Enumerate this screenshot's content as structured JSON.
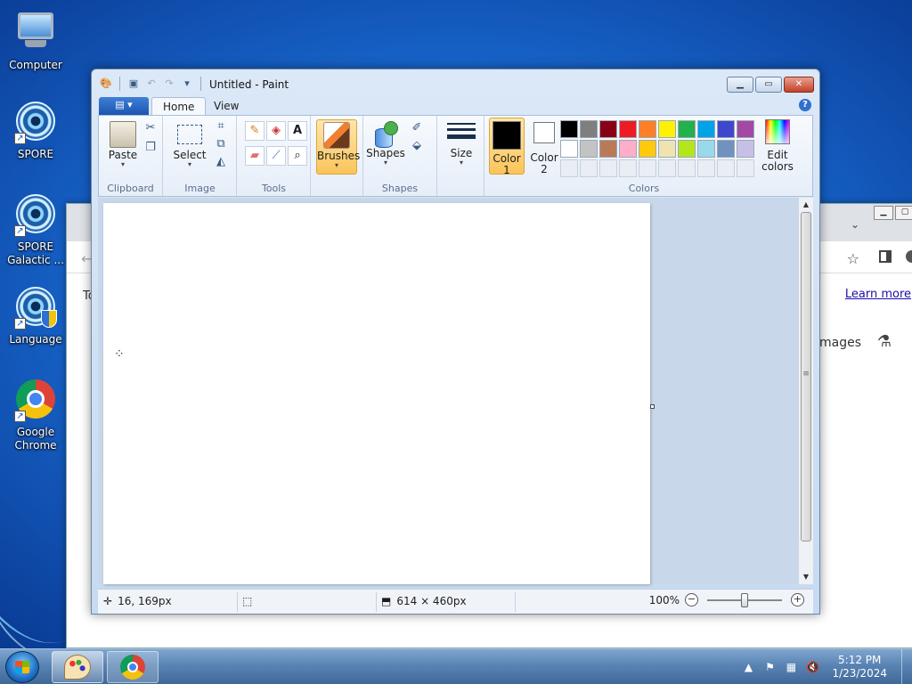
{
  "desktop": {
    "icons": [
      {
        "label": "Computer"
      },
      {
        "label": "SPORE"
      },
      {
        "label": "SPORE Galactic ..."
      },
      {
        "label": "Language"
      },
      {
        "label": "Google Chrome"
      }
    ]
  },
  "chrome_window": {
    "learn_more": "Learn more",
    "images": "Images",
    "partial_text": "To"
  },
  "paint": {
    "title": "Untitled - Paint",
    "tabs": [
      {
        "label": "Home"
      },
      {
        "label": "View"
      }
    ],
    "groups": {
      "clipboard": "Clipboard",
      "image": "Image",
      "tools": "Tools",
      "shapes": "Shapes",
      "colors": "Colors"
    },
    "buttons": {
      "paste": "Paste",
      "select": "Select",
      "brushes": "Brushes",
      "shapes": "Shapes",
      "size": "Size",
      "color1": "Color 1",
      "color2": "Color 2",
      "edit_colors": "Edit colors"
    },
    "color1": "#000000",
    "color2": "#ffffff",
    "palette_row1": [
      "#000000",
      "#7f7f7f",
      "#880015",
      "#ed1c24",
      "#ff7f27",
      "#fff200",
      "#22b14c",
      "#00a2e8",
      "#3f48cc",
      "#a349a4"
    ],
    "palette_row2": [
      "#ffffff",
      "#c3c3c3",
      "#b97a57",
      "#ffaec9",
      "#ffc90e",
      "#efe4b0",
      "#b5e61d",
      "#99d9ea",
      "#7092be",
      "#c8bfe7"
    ],
    "status": {
      "cursor_pos": "16, 169px",
      "image_size": "614 × 460px",
      "zoom": "100%"
    }
  },
  "taskbar": {
    "time": "5:12 PM",
    "date": "1/23/2024"
  }
}
